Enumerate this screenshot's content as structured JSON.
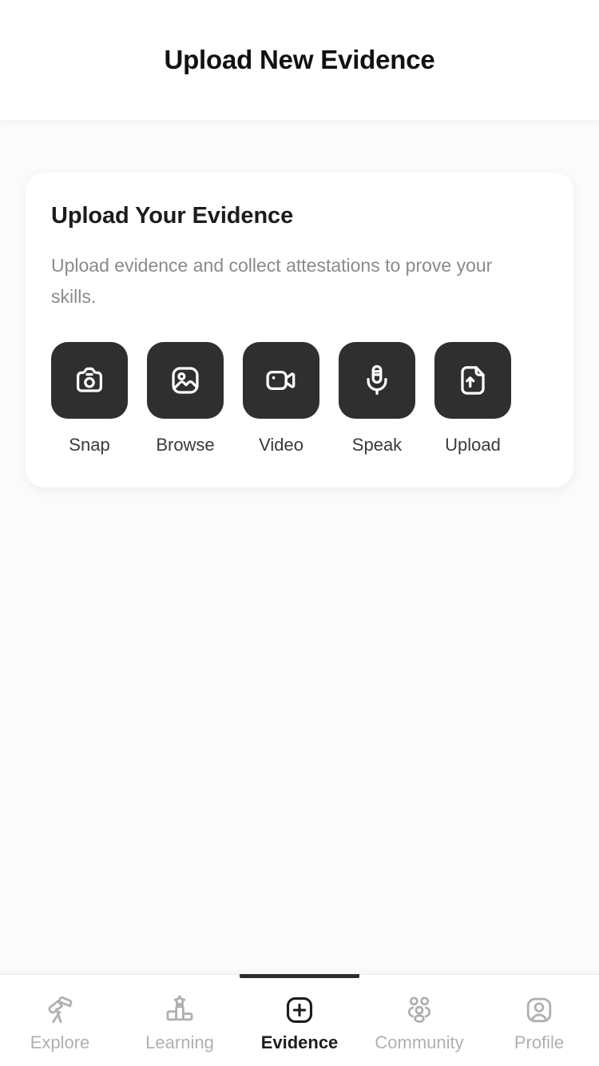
{
  "header": {
    "title": "Upload New Evidence"
  },
  "card": {
    "title": "Upload Your Evidence",
    "subtitle": "Upload evidence and collect attestations to prove your skills.",
    "actions": [
      {
        "label": "Snap",
        "icon": "camera-icon"
      },
      {
        "label": "Browse",
        "icon": "image-icon"
      },
      {
        "label": "Video",
        "icon": "video-camera-icon"
      },
      {
        "label": "Speak",
        "icon": "microphone-icon"
      },
      {
        "label": "Upload",
        "icon": "file-upload-icon"
      }
    ]
  },
  "bottom_nav": {
    "items": [
      {
        "label": "Explore",
        "icon": "telescope-icon",
        "active": false
      },
      {
        "label": "Learning",
        "icon": "podium-star-icon",
        "active": false
      },
      {
        "label": "Evidence",
        "icon": "plus-square-icon",
        "active": true
      },
      {
        "label": "Community",
        "icon": "people-group-icon",
        "active": false
      },
      {
        "label": "Profile",
        "icon": "person-square-icon",
        "active": false
      }
    ]
  },
  "colors": {
    "page_background": "#fbfbfb",
    "surface": "#ffffff",
    "tile_dark": "#2f2f2f",
    "text_primary": "#1c1c1c",
    "text_secondary": "#8a8a8a",
    "nav_inactive": "#b0b0b0",
    "accent": "#2b2b2b"
  }
}
